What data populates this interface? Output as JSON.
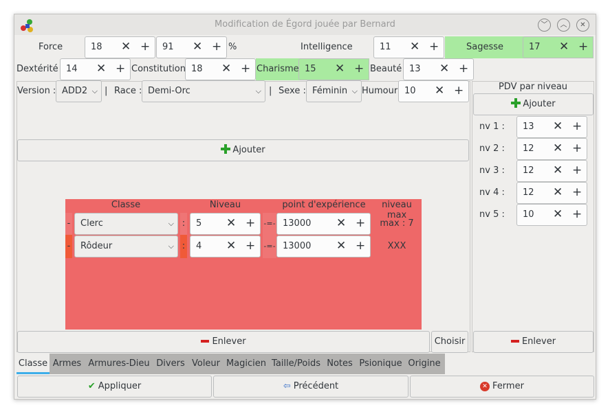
{
  "window": {
    "title": "Modification de Égord jouée par Bernard"
  },
  "stats": {
    "force_label": "Force",
    "force": "18",
    "force2": "91",
    "percent": "%",
    "intelligence_label": "Intelligence",
    "intelligence": "11",
    "sagesse_label": "Sagesse",
    "sagesse": "17",
    "dexterite_label": "Dextérité",
    "dexterite": "14",
    "constitution_label": "Constitution",
    "constitution": "18",
    "charisme_label": "Charisme",
    "charisme": "15",
    "beaute_label": "Beauté",
    "beaute": "13"
  },
  "info": {
    "version_label": "Version :",
    "version": "ADD2",
    "sep1": "|",
    "race_label": "Race :",
    "race": "Demi-Orc",
    "sep2": "|",
    "sexe_label": "Sexe :",
    "sexe": "Féminin",
    "humour_label": "Humour",
    "humour": "10"
  },
  "classes": {
    "add_label": "Ajouter",
    "headers": [
      "Classe",
      "Niveau",
      "point d'expérience",
      "niveau max"
    ],
    "rows": [
      {
        "dash": "-",
        "classe": "Clerc",
        "colon": ":",
        "niveau": "5",
        "sep": "-=-",
        "xp": "13000",
        "max": "max : 7"
      },
      {
        "dash": "-",
        "classe": "Rôdeur",
        "colon": ":",
        "niveau": "4",
        "sep": "-=-",
        "xp": "13000",
        "max": "XXX"
      }
    ],
    "remove_label": "Enlever",
    "choose_label": "Choisir"
  },
  "pdv": {
    "title": "PDV par niveau",
    "add_label": "Ajouter",
    "remove_label": "Enlever",
    "levels": [
      {
        "label": "nv 1 :",
        "value": "13"
      },
      {
        "label": "nv 2 :",
        "value": "12"
      },
      {
        "label": "nv 3 :",
        "value": "12"
      },
      {
        "label": "nv 4 :",
        "value": "12"
      },
      {
        "label": "nv 5 :",
        "value": "10"
      }
    ]
  },
  "tabs": [
    "Classe",
    "Armes",
    "Armures-Dieu",
    "Divers",
    "Voleur",
    "Magicien",
    "Taille/Poids",
    "Notes",
    "Psionique",
    "Origine"
  ],
  "footer": {
    "apply": "Appliquer",
    "previous": "Précédent",
    "close": "Fermer"
  },
  "glyphs": {
    "clear": "✕",
    "plus": "+",
    "chevron": "⌵"
  },
  "colors": {
    "green": "#a9eaa0",
    "red": "#ee6868",
    "tabs_bg": "#b3b2b0"
  }
}
